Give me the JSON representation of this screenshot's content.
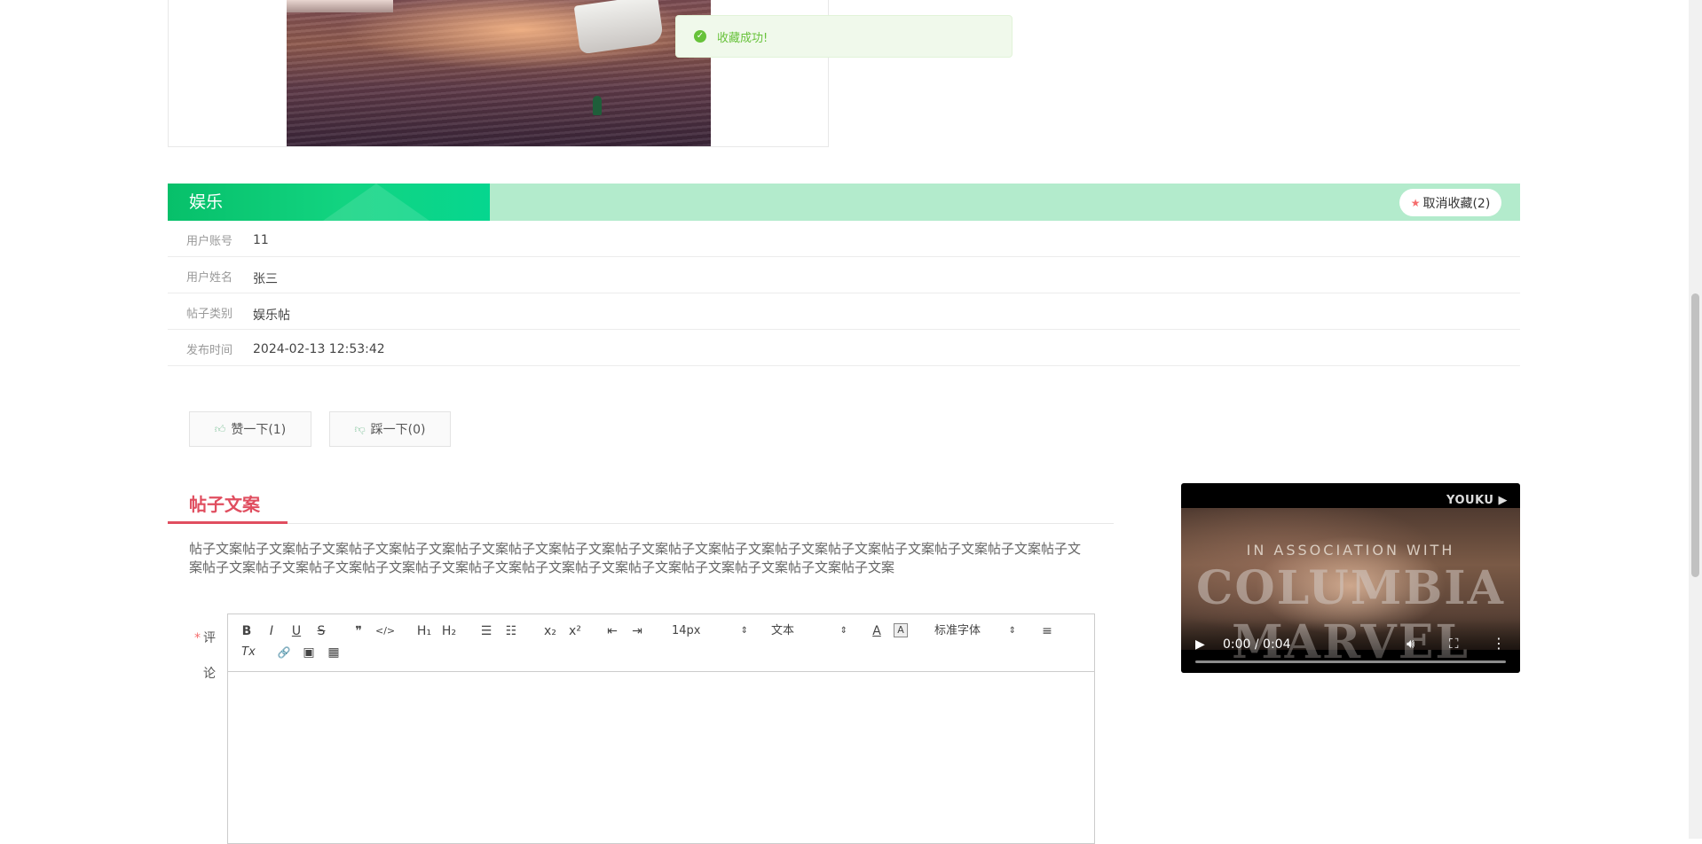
{
  "toast": {
    "message": "收藏成功!",
    "icon": "check-circle-icon",
    "color": "#67c23a"
  },
  "category": {
    "title": "娱乐",
    "favorite_button": "取消收藏(2)",
    "favorite_icon": "star-icon",
    "colors": {
      "accent": "#07c06a",
      "bar": "#b3ebcc"
    }
  },
  "info": [
    {
      "label": "用户账号",
      "value": "11"
    },
    {
      "label": "用户姓名",
      "value": "张三"
    },
    {
      "label": "帖子类别",
      "value": "娱乐帖"
    },
    {
      "label": "发布时间",
      "value": "2024-02-13 12:53:42"
    }
  ],
  "votes": {
    "like": "赞一下(1)",
    "dislike": "踩一下(0)"
  },
  "section": {
    "title": "帖子文案",
    "content": "帖子文案帖子文案帖子文案帖子文案帖子文案帖子文案帖子文案帖子文案帖子文案帖子文案帖子文案帖子文案帖子文案帖子文案帖子文案帖子文案帖子文案帖子文案帖子文案帖子文案帖子文案帖子文案帖子文案帖子文案帖子文案帖子文案帖子文案帖子文案帖子文案帖子文案",
    "title_color": "#e04e5f"
  },
  "comment": {
    "required_mark": "*",
    "label": "评论"
  },
  "editor": {
    "toolbar": {
      "bold": "B",
      "italic": "I",
      "underline": "U",
      "strike": "S",
      "blockquote": "❞",
      "code": "</>",
      "h1": "H₁",
      "h2": "H₂",
      "ordered_list": "☰",
      "bullet_list": "☷",
      "subscript": "x₂",
      "superscript": "x²",
      "outdent": "⇤",
      "indent": "⇥",
      "size": "14px",
      "header": "文本",
      "font": "标准字体",
      "color": "A",
      "background": "A",
      "align": "≡",
      "clean": "Tx",
      "link": "🔗",
      "image": "▣",
      "video": "▦"
    }
  },
  "video": {
    "brand": "YOUKU ▶",
    "frame_text_1": "IN ASSOCIATION WITH",
    "frame_text_2": "COLUMBIA MARVEL",
    "time": "0:00 / 0:04",
    "play_icon": "play-icon",
    "volume_icon": "volume-icon",
    "fullscreen_icon": "fullscreen-icon",
    "more_icon": "more-vertical-icon",
    "progress": 0
  }
}
